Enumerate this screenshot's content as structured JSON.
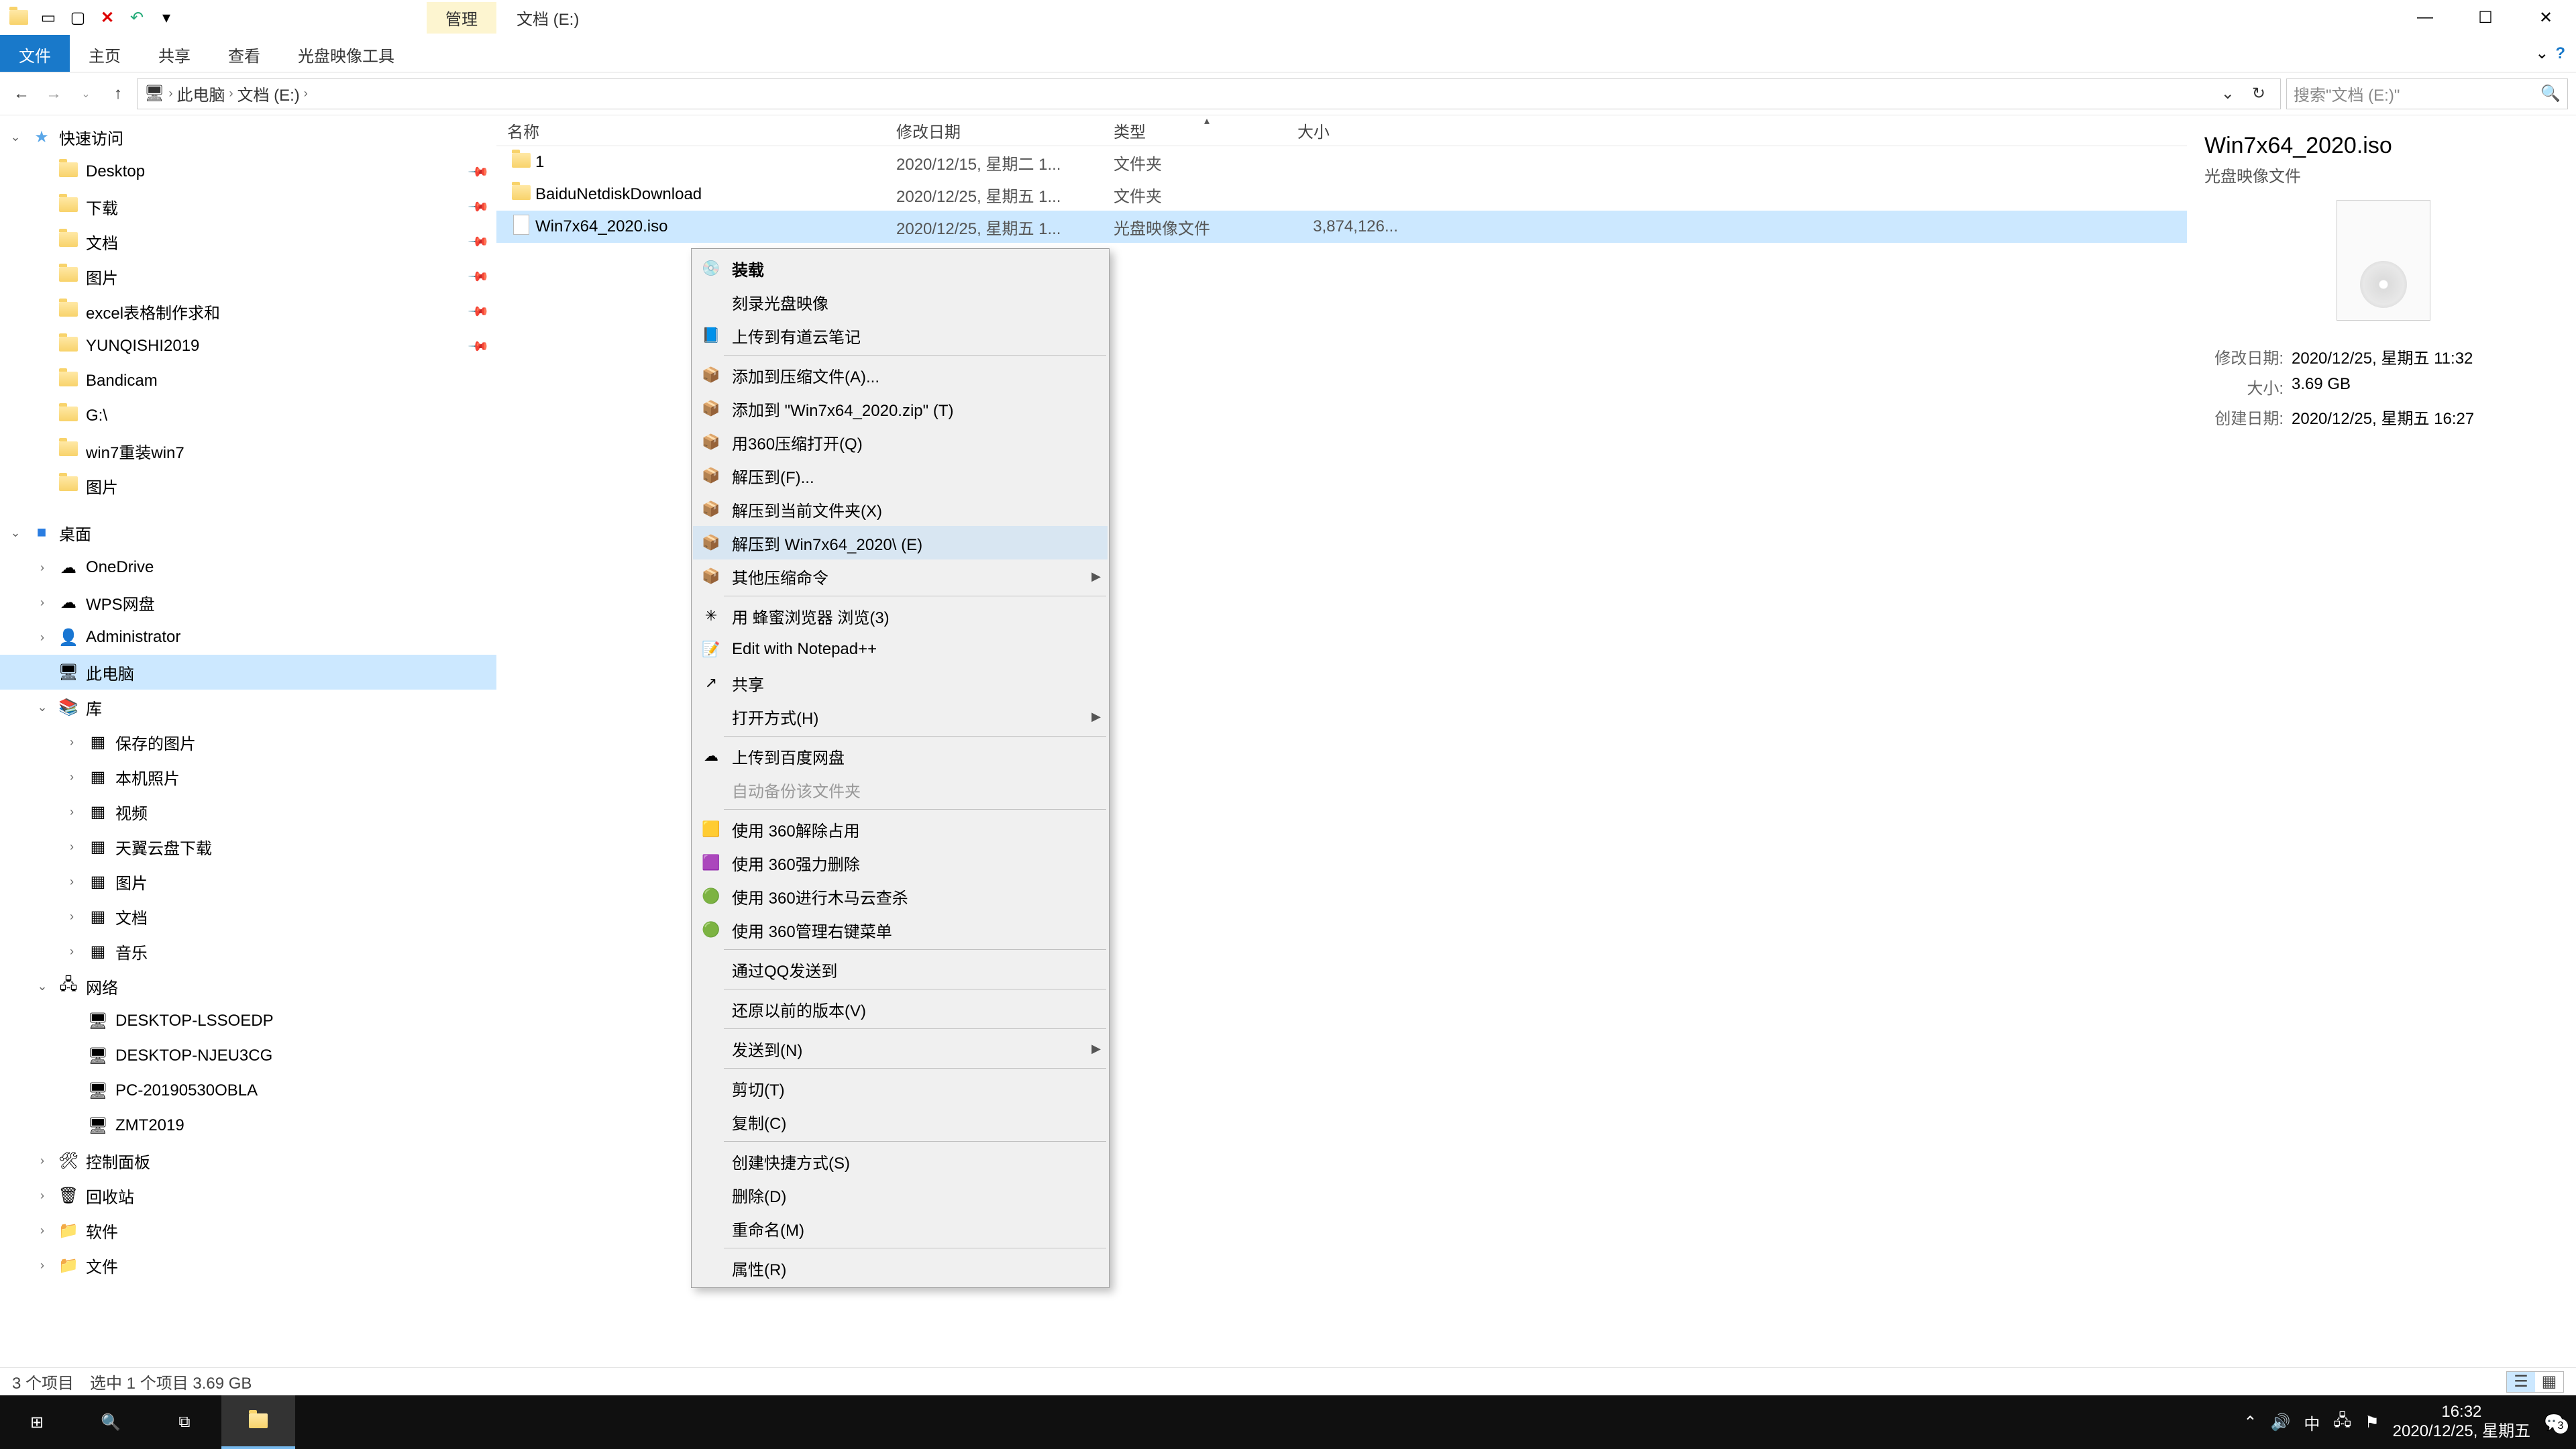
{
  "title_tab": "管理",
  "window_title": "文档 (E:)",
  "ribbon": {
    "file": "文件",
    "tabs": [
      "主页",
      "共享",
      "查看",
      "光盘映像工具"
    ]
  },
  "breadcrumb": [
    "此电脑",
    "文档 (E:)"
  ],
  "search_placeholder": "搜索\"文档 (E:)\"",
  "columns": {
    "name": "名称",
    "date": "修改日期",
    "type": "类型",
    "size": "大小"
  },
  "nav": {
    "quick": "快速访问",
    "quick_items": [
      "Desktop",
      "下载",
      "文档",
      "图片",
      "excel表格制作求和",
      "YUNQISHI2019",
      "Bandicam",
      "G:\\",
      "win7重装win7",
      "图片"
    ],
    "desktop": "桌面",
    "desktop_items": [
      "OneDrive",
      "WPS网盘",
      "Administrator",
      "此电脑",
      "库"
    ],
    "lib_items": [
      "保存的图片",
      "本机照片",
      "视频",
      "天翼云盘下载",
      "图片",
      "文档",
      "音乐"
    ],
    "network": "网络",
    "net_items": [
      "DESKTOP-LSSOEDP",
      "DESKTOP-NJEU3CG",
      "PC-20190530OBLA",
      "ZMT2019"
    ],
    "misc": [
      "控制面板",
      "回收站",
      "软件",
      "文件"
    ]
  },
  "files": [
    {
      "name": "1",
      "date": "2020/12/15, 星期二 1...",
      "type": "文件夹",
      "size": "",
      "icon": "folder"
    },
    {
      "name": "BaiduNetdiskDownload",
      "date": "2020/12/25, 星期五 1...",
      "type": "文件夹",
      "size": "",
      "icon": "folder"
    },
    {
      "name": "Win7x64_2020.iso",
      "date": "2020/12/25, 星期五 1...",
      "type": "光盘映像文件",
      "size": "3,874,126...",
      "icon": "file",
      "selected": true
    }
  ],
  "details": {
    "title": "Win7x64_2020.iso",
    "type": "光盘映像文件",
    "rows": [
      {
        "label": "修改日期:",
        "value": "2020/12/25, 星期五 11:32"
      },
      {
        "label": "大小:",
        "value": "3.69 GB"
      },
      {
        "label": "创建日期:",
        "value": "2020/12/25, 星期五 16:27"
      }
    ]
  },
  "context_menu": [
    {
      "type": "item",
      "label": "装载",
      "bold": true,
      "icon": "💿"
    },
    {
      "type": "item",
      "label": "刻录光盘映像"
    },
    {
      "type": "item",
      "label": "上传到有道云笔记",
      "icon": "📘"
    },
    {
      "type": "sep"
    },
    {
      "type": "item",
      "label": "添加到压缩文件(A)...",
      "icon": "📦"
    },
    {
      "type": "item",
      "label": "添加到 \"Win7x64_2020.zip\" (T)",
      "icon": "📦"
    },
    {
      "type": "item",
      "label": "用360压缩打开(Q)",
      "icon": "📦"
    },
    {
      "type": "item",
      "label": "解压到(F)...",
      "icon": "📦"
    },
    {
      "type": "item",
      "label": "解压到当前文件夹(X)",
      "icon": "📦"
    },
    {
      "type": "item",
      "label": "解压到 Win7x64_2020\\ (E)",
      "icon": "📦",
      "hover": true
    },
    {
      "type": "item",
      "label": "其他压缩命令",
      "icon": "📦",
      "submenu": true
    },
    {
      "type": "sep"
    },
    {
      "type": "item",
      "label": "用 蜂蜜浏览器 浏览(3)",
      "icon": "✳"
    },
    {
      "type": "item",
      "label": "Edit with Notepad++",
      "icon": "📝"
    },
    {
      "type": "item",
      "label": "共享",
      "icon": "↗"
    },
    {
      "type": "item",
      "label": "打开方式(H)",
      "submenu": true
    },
    {
      "type": "sep"
    },
    {
      "type": "item",
      "label": "上传到百度网盘",
      "icon": "☁"
    },
    {
      "type": "item",
      "label": "自动备份该文件夹",
      "disabled": true
    },
    {
      "type": "sep"
    },
    {
      "type": "item",
      "label": "使用 360解除占用",
      "icon": "🟨"
    },
    {
      "type": "item",
      "label": "使用 360强力删除",
      "icon": "🟪"
    },
    {
      "type": "item",
      "label": "使用 360进行木马云查杀",
      "icon": "🟢"
    },
    {
      "type": "item",
      "label": "使用 360管理右键菜单",
      "icon": "🟢"
    },
    {
      "type": "sep"
    },
    {
      "type": "item",
      "label": "通过QQ发送到"
    },
    {
      "type": "sep"
    },
    {
      "type": "item",
      "label": "还原以前的版本(V)"
    },
    {
      "type": "sep"
    },
    {
      "type": "item",
      "label": "发送到(N)",
      "submenu": true
    },
    {
      "type": "sep"
    },
    {
      "type": "item",
      "label": "剪切(T)"
    },
    {
      "type": "item",
      "label": "复制(C)"
    },
    {
      "type": "sep"
    },
    {
      "type": "item",
      "label": "创建快捷方式(S)"
    },
    {
      "type": "item",
      "label": "删除(D)"
    },
    {
      "type": "item",
      "label": "重命名(M)"
    },
    {
      "type": "sep"
    },
    {
      "type": "item",
      "label": "属性(R)"
    }
  ],
  "status": {
    "count": "3 个项目",
    "selection": "选中 1 个项目  3.69 GB"
  },
  "taskbar": {
    "time": "16:32",
    "date": "2020/12/25, 星期五",
    "ime": "中",
    "badge": "3"
  }
}
